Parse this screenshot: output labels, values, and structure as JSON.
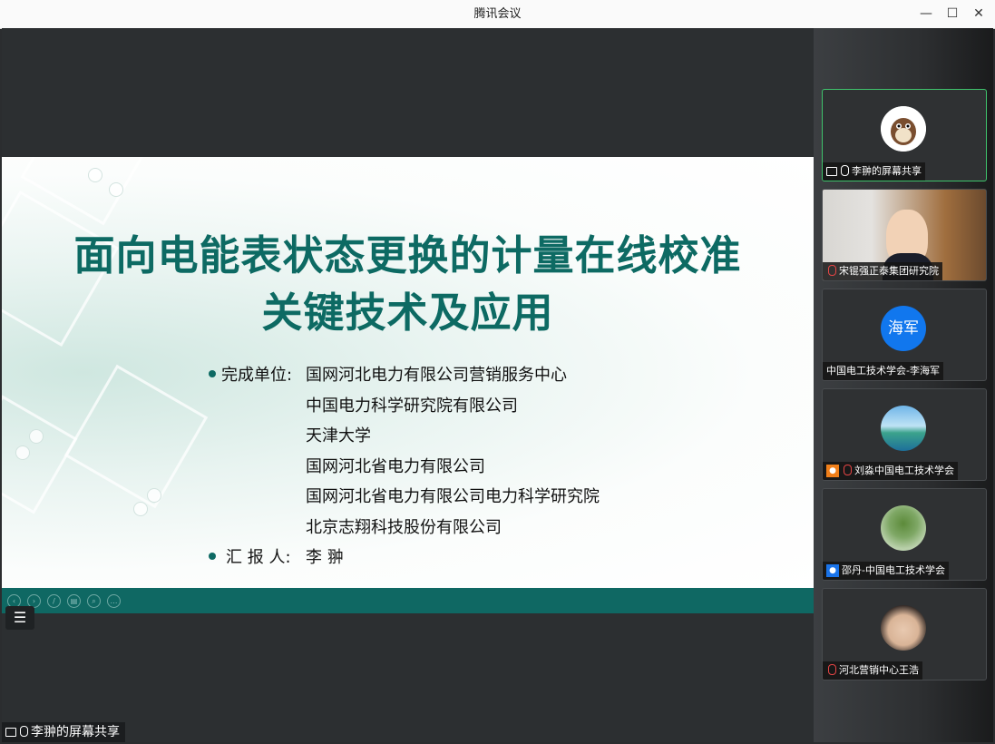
{
  "window": {
    "title": "腾讯会议",
    "minimize": "—",
    "maximize": "☐",
    "close": "✕"
  },
  "slide": {
    "title_line1": "面向电能表状态更换的计量在线校准",
    "title_line2": "关键技术及应用",
    "units_label": "完成单位:",
    "units": [
      "国网河北电力有限公司营销服务中心",
      "中国电力科学研究院有限公司",
      "天津大学",
      "国网河北省电力有限公司",
      "国网河北省电力有限公司电力科学研究院",
      "北京志翔科技股份有限公司"
    ],
    "reporter_label": "汇 报 人:",
    "reporter": "李 翀"
  },
  "toolbar": {
    "menu_icon": "☰"
  },
  "share_label": "李翀的屏幕共享",
  "participants": [
    {
      "name": "李翀的屏幕共享",
      "avatar_text": "",
      "mic": "on",
      "screen": true,
      "user_icon": ""
    },
    {
      "name": "宋锟强正泰集团研究院",
      "avatar_text": "",
      "mic": "muted",
      "screen": false,
      "user_icon": ""
    },
    {
      "name": "中国电工技术学会-李海军",
      "avatar_text": "海军",
      "mic": "none",
      "screen": false,
      "user_icon": ""
    },
    {
      "name": "刘淼中国电工技术学会",
      "avatar_text": "",
      "mic": "muted",
      "screen": false,
      "user_icon": "orange"
    },
    {
      "name": "邵丹-中国电工技术学会",
      "avatar_text": "",
      "mic": "none",
      "screen": false,
      "user_icon": "blue"
    },
    {
      "name": "河北营销中心王浩",
      "avatar_text": "",
      "mic": "muted",
      "screen": false,
      "user_icon": ""
    }
  ],
  "colors": {
    "accent": "#0d6a63",
    "teal_bar": "#0f6863",
    "active_border": "#3fc36c",
    "avatar_blue": "#1177ee"
  }
}
